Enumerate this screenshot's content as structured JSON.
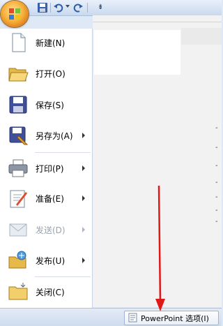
{
  "quick_access_toolbar": {
    "buttons": [
      {
        "icon": "office-logo-icon"
      },
      {
        "icon": "save-icon"
      },
      {
        "icon": "undo-icon"
      },
      {
        "icon": "redo-icon"
      }
    ],
    "customize_glyph": "⇟"
  },
  "menu": {
    "items": [
      {
        "label": "新建(N)",
        "icon": "new-document-icon",
        "has_submenu": false,
        "enabled": true
      },
      {
        "label": "打开(O)",
        "icon": "open-folder-icon",
        "has_submenu": false,
        "enabled": true
      },
      {
        "label": "保存(S)",
        "icon": "save-disk-icon",
        "has_submenu": false,
        "enabled": true
      },
      {
        "label": "另存为(A)",
        "icon": "save-as-icon",
        "has_submenu": true,
        "enabled": true
      },
      {
        "label": "打印(P)",
        "icon": "printer-icon",
        "has_submenu": true,
        "enabled": true
      },
      {
        "label": "准备(E)",
        "icon": "prepare-icon",
        "has_submenu": true,
        "enabled": true
      },
      {
        "label": "发送(D)",
        "icon": "send-icon",
        "has_submenu": true,
        "enabled": false
      },
      {
        "label": "发布(U)",
        "icon": "publish-icon",
        "has_submenu": true,
        "enabled": true
      },
      {
        "label": "关闭(C)",
        "icon": "close-folder-icon",
        "has_submenu": false,
        "enabled": true
      }
    ]
  },
  "right_panel": {
    "side_glyphs": [
      "-",
      "-",
      "-",
      "-",
      "-",
      "-",
      "-"
    ]
  },
  "bottom": {
    "options_button_label": "PowerPoint 选项(I)",
    "options_icon": "options-icon"
  },
  "annotation": {
    "arrow_color": "#e01818"
  },
  "colors": {
    "office_button": "#f7b13c",
    "menu_bg": "#ffffff",
    "panel_bg": "#f2f2f2",
    "chrome_blue": "#dfe8f5"
  }
}
